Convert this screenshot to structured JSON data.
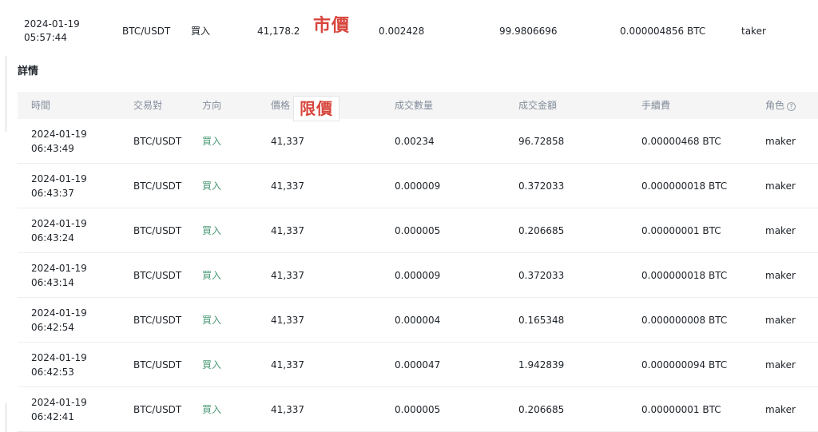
{
  "top_trade": {
    "time": "2024-01-19 05:57:44",
    "pair": "BTC/USDT",
    "side": "買入",
    "price": "41,178.2",
    "tag": "市價",
    "quantity": "0.002428",
    "amount": "99.9806696",
    "fee": "0.000004856 BTC",
    "role": "taker"
  },
  "section_title": "詳情",
  "limit_tag": "限價",
  "headers": {
    "time": "時間",
    "pair": "交易對",
    "side": "方向",
    "price": "價格",
    "quantity": "成交數量",
    "amount": "成交金額",
    "fee": "手續費",
    "role": "角色",
    "role_help_icon": "?"
  },
  "rows": [
    {
      "time": "2024-01-19 06:43:49",
      "pair": "BTC/USDT",
      "side": "買入",
      "price": "41,337",
      "quantity": "0.00234",
      "amount": "96.72858",
      "fee": "0.00000468 BTC",
      "role": "maker"
    },
    {
      "time": "2024-01-19 06:43:37",
      "pair": "BTC/USDT",
      "side": "買入",
      "price": "41,337",
      "quantity": "0.000009",
      "amount": "0.372033",
      "fee": "0.000000018 BTC",
      "role": "maker"
    },
    {
      "time": "2024-01-19 06:43:24",
      "pair": "BTC/USDT",
      "side": "買入",
      "price": "41,337",
      "quantity": "0.000005",
      "amount": "0.206685",
      "fee": "0.00000001 BTC",
      "role": "maker"
    },
    {
      "time": "2024-01-19 06:43:14",
      "pair": "BTC/USDT",
      "side": "買入",
      "price": "41,337",
      "quantity": "0.000009",
      "amount": "0.372033",
      "fee": "0.000000018 BTC",
      "role": "maker"
    },
    {
      "time": "2024-01-19 06:42:54",
      "pair": "BTC/USDT",
      "side": "買入",
      "price": "41,337",
      "quantity": "0.000004",
      "amount": "0.165348",
      "fee": "0.000000008 BTC",
      "role": "maker"
    },
    {
      "time": "2024-01-19 06:42:53",
      "pair": "BTC/USDT",
      "side": "買入",
      "price": "41,337",
      "quantity": "0.000047",
      "amount": "1.942839",
      "fee": "0.000000094 BTC",
      "role": "maker"
    },
    {
      "time": "2024-01-19 06:42:41",
      "pair": "BTC/USDT",
      "side": "買入",
      "price": "41,337",
      "quantity": "0.000005",
      "amount": "0.206685",
      "fee": "0.00000001 BTC",
      "role": "maker"
    }
  ],
  "colors": {
    "buy": "#4e9c78",
    "annotation_red": "#d7463c",
    "header_bg": "#f5f5f5",
    "header_text": "#848e9c"
  }
}
